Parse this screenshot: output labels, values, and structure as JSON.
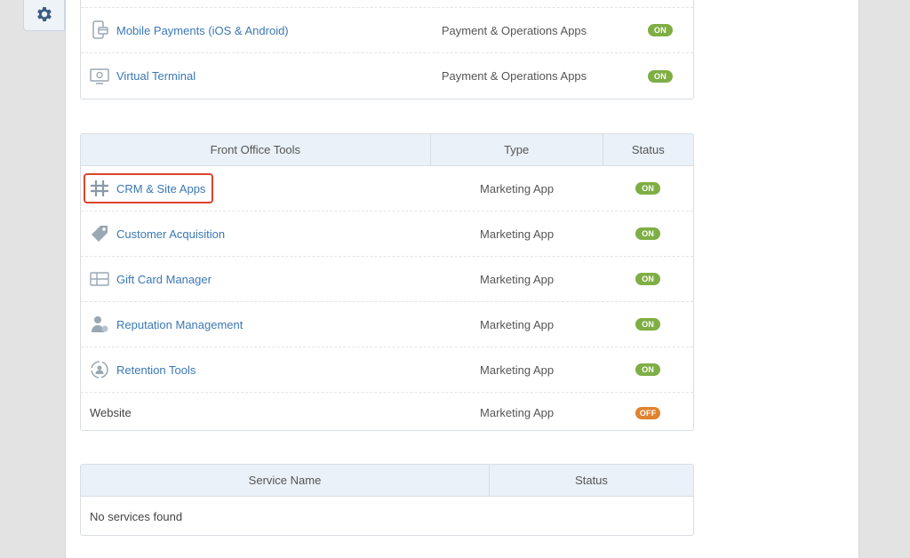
{
  "colors": {
    "link": "#3a78b5",
    "on": "#7fae45",
    "off": "#e0822f",
    "highlight": "#d9452b"
  },
  "payment_apps": {
    "rows": [
      {
        "name": "Mobile Payments (iOS & Android)",
        "type": "Payment & Operations Apps",
        "status": "ON",
        "icon": "mobile-payments-icon"
      },
      {
        "name": "Virtual Terminal",
        "type": "Payment & Operations Apps",
        "status": "ON",
        "icon": "virtual-terminal-icon"
      }
    ]
  },
  "front_office": {
    "headers": {
      "name": "Front Office Tools",
      "type": "Type",
      "status": "Status"
    },
    "rows": [
      {
        "name": "CRM & Site Apps",
        "type": "Marketing App",
        "status": "ON",
        "icon": "puzzle-icon"
      },
      {
        "name": "Customer Acquisition",
        "type": "Marketing App",
        "status": "ON",
        "icon": "tag-icon"
      },
      {
        "name": "Gift Card Manager",
        "type": "Marketing App",
        "status": "ON",
        "icon": "gift-card-icon"
      },
      {
        "name": "Reputation Management",
        "type": "Marketing App",
        "status": "ON",
        "icon": "person-star-icon"
      },
      {
        "name": "Retention Tools",
        "type": "Marketing App",
        "status": "ON",
        "icon": "retention-icon"
      },
      {
        "name": "Website",
        "type": "Marketing App",
        "status": "OFF"
      }
    ]
  },
  "services": {
    "headers": {
      "name": "Service Name",
      "status": "Status"
    },
    "empty_message": "No services found"
  }
}
